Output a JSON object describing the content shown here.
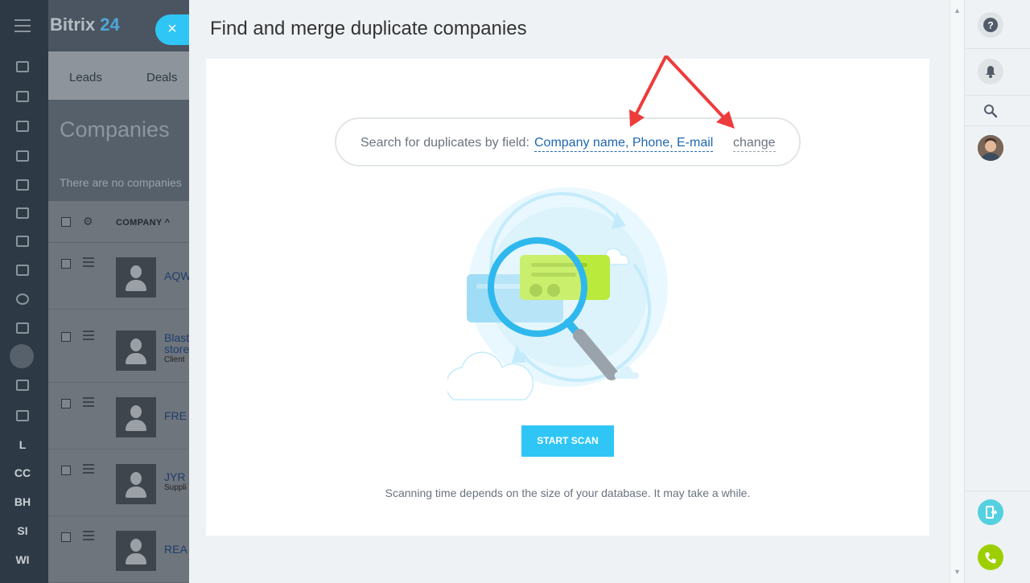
{
  "app": {
    "brand_name": "Bitrix",
    "brand_number": "24"
  },
  "background": {
    "tabs": [
      "Leads",
      "Deals"
    ],
    "page_title": "Companies",
    "empty_text": "There are no companies",
    "grid_header": "COMPANY ^",
    "rows": [
      {
        "name": "AQW",
        "sub": ""
      },
      {
        "name": "Blast",
        "name2": "store",
        "sub": "Client"
      },
      {
        "name": "FRE",
        "sub": ""
      },
      {
        "name": "JYR",
        "sub": "Suppli"
      },
      {
        "name": "REA",
        "sub": ""
      }
    ],
    "sidebar_labels": [
      "L",
      "CC",
      "BH",
      "SI",
      "WI"
    ]
  },
  "close_glyph": "×",
  "slider": {
    "title": "Find and merge duplicate companies",
    "search_label": "Search for duplicates by field:",
    "search_fields": "Company name, Phone, E-mail",
    "change_link": "change",
    "start_button": "START SCAN",
    "note": "Scanning time depends on the size of your database. It may take a while."
  },
  "right_rail": {
    "icons": [
      "help-icon",
      "bell-icon",
      "search-icon",
      "user-avatar",
      "exit-icon",
      "phone-icon"
    ],
    "help_glyph": "?",
    "colors": {
      "help": "#525c69",
      "exit": "#55d0e0",
      "phone": "#9dcf00"
    }
  },
  "colors": {
    "accent": "#2fc6f6",
    "link": "#2067b0",
    "arrow": "#ee3b3b"
  }
}
